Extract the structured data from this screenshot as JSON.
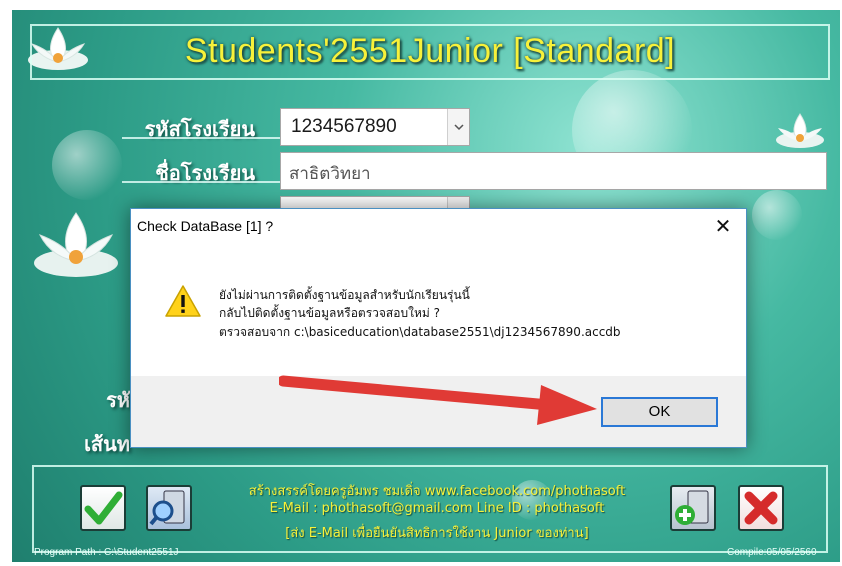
{
  "app": {
    "title": "Students'2551Junior [Standard]",
    "labels": {
      "school_code": "รหัสโรงเรียน",
      "school_name": "ชื่อโรงเรียน",
      "partial_code": "รหั",
      "partial_path": "เส้นท"
    },
    "school_code_value": "1234567890",
    "school_name_value": "สาธิตวิทยา",
    "credits": [
      "สร้างสรรค์โดยครูอัมพร ชมเดิ่จ  www.facebook.com/phothasoft",
      "E-Mail : phothasoft@gmail.com  Line ID : phothasoft",
      "[ส่ง E-Mail เพื่อยืนยันสิทธิการใช้งาน Junior  ของท่าน]"
    ],
    "program_path": "Program Path : C:\\Student2551J",
    "compile": "Compile:05/05/2560"
  },
  "dialog": {
    "title": "Check DataBase [1] ?",
    "close": "✕",
    "message_lines": [
      "ยังไม่ผ่านการติดตั้งฐานข้อมูลสำหรับนักเรียนรุ่นนี้",
      "กลับไปติดตั้งฐานข้อมูลหรือตรวจสอบใหม่ ?",
      "ตรวจสอบจาก c:\\basiceducation\\database2551\\dj1234567890.accdb"
    ],
    "ok_label": "OK"
  },
  "icons": {
    "warning": "warning-icon",
    "check": "checkmark-icon",
    "search": "search-computer-icon",
    "add_db": "add-database-icon",
    "exit": "close-x-icon"
  },
  "colors": {
    "title_yellow": "#f7f13a",
    "teal_bg": "#2c9b86",
    "ok_border": "#2a78d6",
    "arrow_red": "#e03a35"
  }
}
